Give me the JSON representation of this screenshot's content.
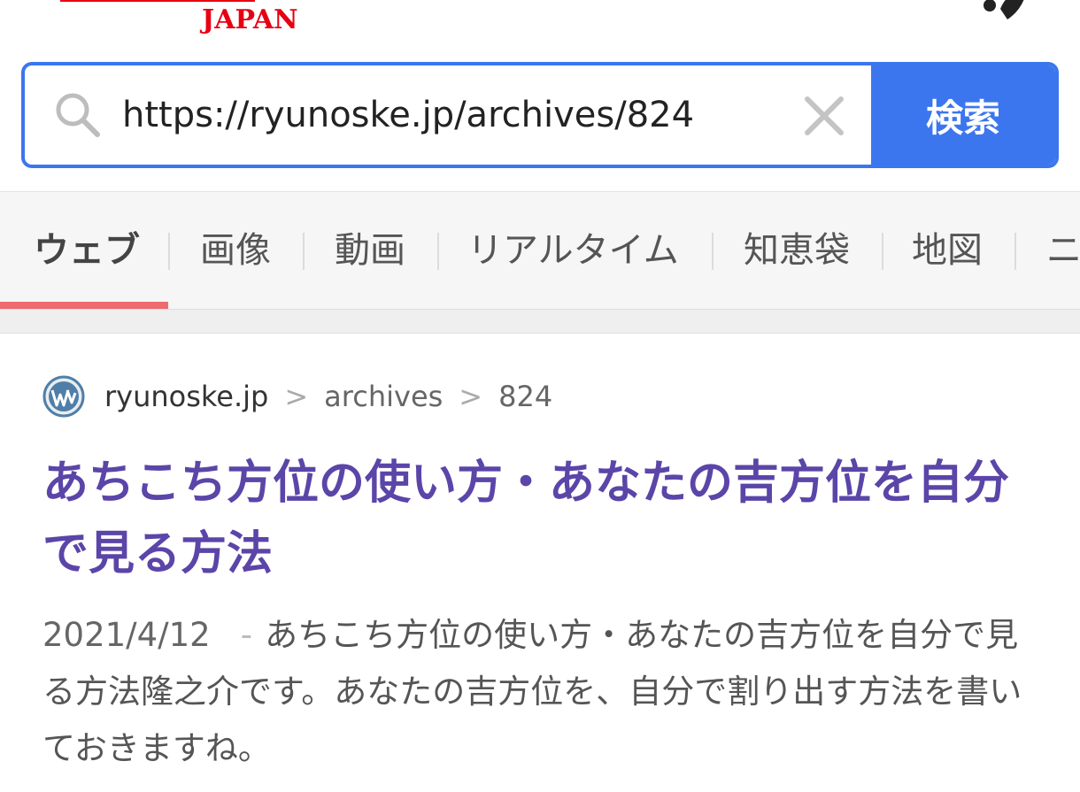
{
  "header": {
    "logo_text": "JAPAN",
    "colors": {
      "logo": "#e60012",
      "accent": "#3c76ee",
      "tab_indicator": "#ee6b70",
      "title_link": "#5b45a8"
    }
  },
  "search": {
    "value": "https://ryunoske.jp/archives/824",
    "button_label": "検索"
  },
  "tabs": [
    {
      "label": "ウェブ",
      "active": true
    },
    {
      "label": "画像"
    },
    {
      "label": "動画"
    },
    {
      "label": "リアルタイム"
    },
    {
      "label": "知恵袋"
    },
    {
      "label": "地図"
    },
    {
      "label": "ニ"
    }
  ],
  "result": {
    "breadcrumb": [
      "ryunoske.jp",
      "archives",
      "824"
    ],
    "breadcrumb_sep": ">",
    "title": "あちこち方位の使い方・あなたの吉方位を自分で見る方法",
    "date": "2021/4/12",
    "dash": "-",
    "snippet": "あちこち方位の使い方・あなたの吉方位を自分で見る方法隆之介です。あなたの吉方位を、自分で割り出す方法を書いておきますね。"
  }
}
